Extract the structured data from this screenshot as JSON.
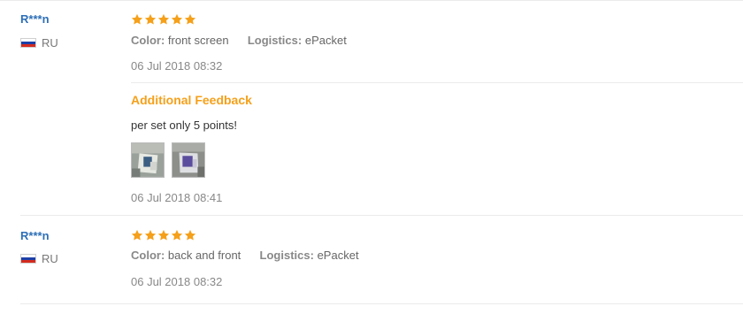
{
  "reviews": [
    {
      "user": "R***n",
      "country": "RU",
      "stars": 5,
      "attributes": [
        {
          "label": "Color:",
          "value": "front screen"
        },
        {
          "label": "Logistics:",
          "value": "ePacket"
        }
      ],
      "date": "06 Jul 2018 08:32",
      "additional": {
        "title": "Additional Feedback",
        "text": "per set only 5 points!",
        "photos": [
          "product-photo",
          "product-photo"
        ],
        "date": "06 Jul 2018 08:41"
      }
    },
    {
      "user": "R***n",
      "country": "RU",
      "stars": 5,
      "attributes": [
        {
          "label": "Color:",
          "value": "back and front"
        },
        {
          "label": "Logistics:",
          "value": "ePacket"
        }
      ],
      "date": "06 Jul 2018 08:32"
    }
  ],
  "colors": {
    "star": "#f5a01a",
    "username": "#2d6fb7",
    "additional_title": "#f5a01a"
  },
  "flag_colors": [
    "#ffffff",
    "#1c3fa8",
    "#d52b1e"
  ]
}
